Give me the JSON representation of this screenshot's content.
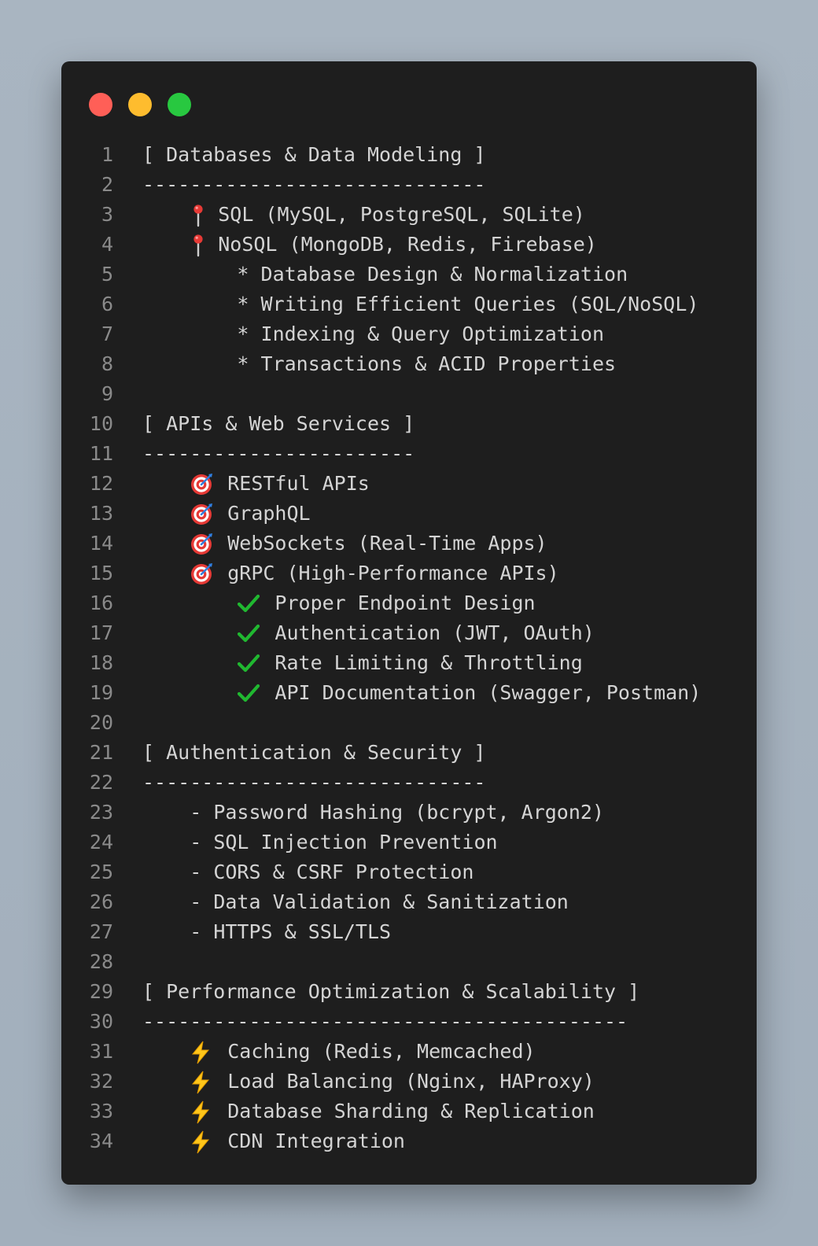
{
  "window": {
    "lights": [
      "#ff5f57",
      "#febc2e",
      "#28c840"
    ]
  },
  "lines": [
    {
      "n": "1",
      "indent": "",
      "icon": "",
      "text": "[ Databases & Data Modeling ]"
    },
    {
      "n": "2",
      "indent": "",
      "icon": "",
      "text": "-----------------------------"
    },
    {
      "n": "3",
      "indent": "    ",
      "icon": "pin-icon",
      "text": "SQL (MySQL, PostgreSQL, SQLite)"
    },
    {
      "n": "4",
      "indent": "    ",
      "icon": "pin-icon",
      "text": "NoSQL (MongoDB, Redis, Firebase)"
    },
    {
      "n": "5",
      "indent": "        ",
      "icon": "",
      "text": "* Database Design & Normalization"
    },
    {
      "n": "6",
      "indent": "        ",
      "icon": "",
      "text": "* Writing Efficient Queries (SQL/NoSQL)"
    },
    {
      "n": "7",
      "indent": "        ",
      "icon": "",
      "text": "* Indexing & Query Optimization"
    },
    {
      "n": "8",
      "indent": "        ",
      "icon": "",
      "text": "* Transactions & ACID Properties"
    },
    {
      "n": "9",
      "indent": "",
      "icon": "",
      "text": ""
    },
    {
      "n": "10",
      "indent": "",
      "icon": "",
      "text": "[ APIs & Web Services ]"
    },
    {
      "n": "11",
      "indent": "",
      "icon": "",
      "text": "-----------------------"
    },
    {
      "n": "12",
      "indent": "    ",
      "icon": "target-icon",
      "text": "RESTful APIs"
    },
    {
      "n": "13",
      "indent": "    ",
      "icon": "target-icon",
      "text": "GraphQL"
    },
    {
      "n": "14",
      "indent": "    ",
      "icon": "target-icon",
      "text": "WebSockets (Real-Time Apps)"
    },
    {
      "n": "15",
      "indent": "    ",
      "icon": "target-icon",
      "text": "gRPC (High-Performance APIs)"
    },
    {
      "n": "16",
      "indent": "        ",
      "icon": "check-icon",
      "text": "Proper Endpoint Design"
    },
    {
      "n": "17",
      "indent": "        ",
      "icon": "check-icon",
      "text": "Authentication (JWT, OAuth)"
    },
    {
      "n": "18",
      "indent": "        ",
      "icon": "check-icon",
      "text": "Rate Limiting & Throttling"
    },
    {
      "n": "19",
      "indent": "        ",
      "icon": "check-icon",
      "text": "API Documentation (Swagger, Postman)"
    },
    {
      "n": "20",
      "indent": "",
      "icon": "",
      "text": ""
    },
    {
      "n": "21",
      "indent": "",
      "icon": "",
      "text": "[ Authentication & Security ]"
    },
    {
      "n": "22",
      "indent": "",
      "icon": "",
      "text": "-----------------------------"
    },
    {
      "n": "23",
      "indent": "    ",
      "icon": "",
      "text": "- Password Hashing (bcrypt, Argon2)"
    },
    {
      "n": "24",
      "indent": "    ",
      "icon": "",
      "text": "- SQL Injection Prevention"
    },
    {
      "n": "25",
      "indent": "    ",
      "icon": "",
      "text": "- CORS & CSRF Protection"
    },
    {
      "n": "26",
      "indent": "    ",
      "icon": "",
      "text": "- Data Validation & Sanitization"
    },
    {
      "n": "27",
      "indent": "    ",
      "icon": "",
      "text": "- HTTPS & SSL/TLS"
    },
    {
      "n": "28",
      "indent": "",
      "icon": "",
      "text": ""
    },
    {
      "n": "29",
      "indent": "",
      "icon": "",
      "text": "[ Performance Optimization & Scalability ]"
    },
    {
      "n": "30",
      "indent": "",
      "icon": "",
      "text": "-----------------------------------------"
    },
    {
      "n": "31",
      "indent": "    ",
      "icon": "zap-icon",
      "text": "Caching (Redis, Memcached)"
    },
    {
      "n": "32",
      "indent": "    ",
      "icon": "zap-icon",
      "text": "Load Balancing (Nginx, HAProxy)"
    },
    {
      "n": "33",
      "indent": "    ",
      "icon": "zap-icon",
      "text": "Database Sharding & Replication"
    },
    {
      "n": "34",
      "indent": "    ",
      "icon": "zap-icon",
      "text": "CDN Integration"
    }
  ]
}
